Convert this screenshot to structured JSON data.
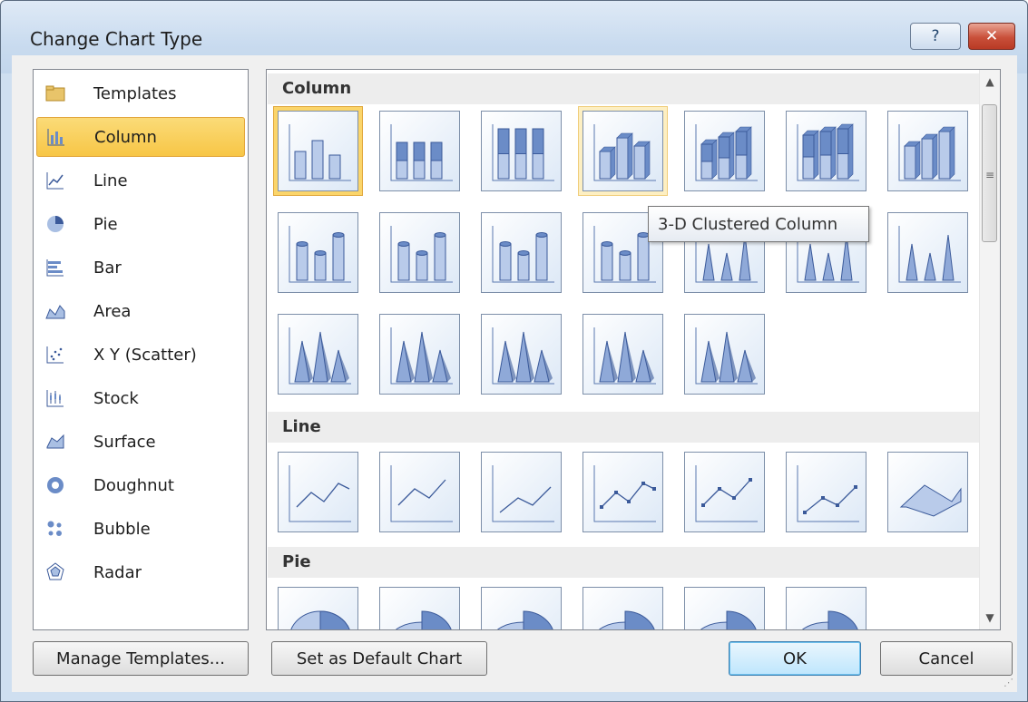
{
  "window": {
    "title": "Change Chart Type",
    "help_glyph": "?",
    "close_glyph": "✕"
  },
  "categories": [
    {
      "label": "Templates",
      "icon": "folder-icon"
    },
    {
      "label": "Column",
      "icon": "column-chart-icon",
      "selected": true
    },
    {
      "label": "Line",
      "icon": "line-chart-icon"
    },
    {
      "label": "Pie",
      "icon": "pie-chart-icon"
    },
    {
      "label": "Bar",
      "icon": "bar-chart-icon"
    },
    {
      "label": "Area",
      "icon": "area-chart-icon"
    },
    {
      "label": "X Y (Scatter)",
      "icon": "scatter-chart-icon"
    },
    {
      "label": "Stock",
      "icon": "stock-chart-icon"
    },
    {
      "label": "Surface",
      "icon": "surface-chart-icon"
    },
    {
      "label": "Doughnut",
      "icon": "doughnut-chart-icon"
    },
    {
      "label": "Bubble",
      "icon": "bubble-chart-icon"
    },
    {
      "label": "Radar",
      "icon": "radar-chart-icon"
    }
  ],
  "sections": {
    "column": {
      "header": "Column",
      "count": 19,
      "selected_index": 0,
      "hovered_index": 3
    },
    "line": {
      "header": "Line",
      "count": 7
    },
    "pie": {
      "header": "Pie",
      "count": 6
    }
  },
  "tooltip": "3-D Clustered Column",
  "buttons": {
    "manage_templates": "Manage Templates...",
    "set_default": "Set as Default Chart",
    "ok": "OK",
    "cancel": "Cancel"
  },
  "colors": {
    "accent_selected": "#fbd56a",
    "chart_blue": "#6b8cc7",
    "chart_dark": "#3b5a9a"
  }
}
